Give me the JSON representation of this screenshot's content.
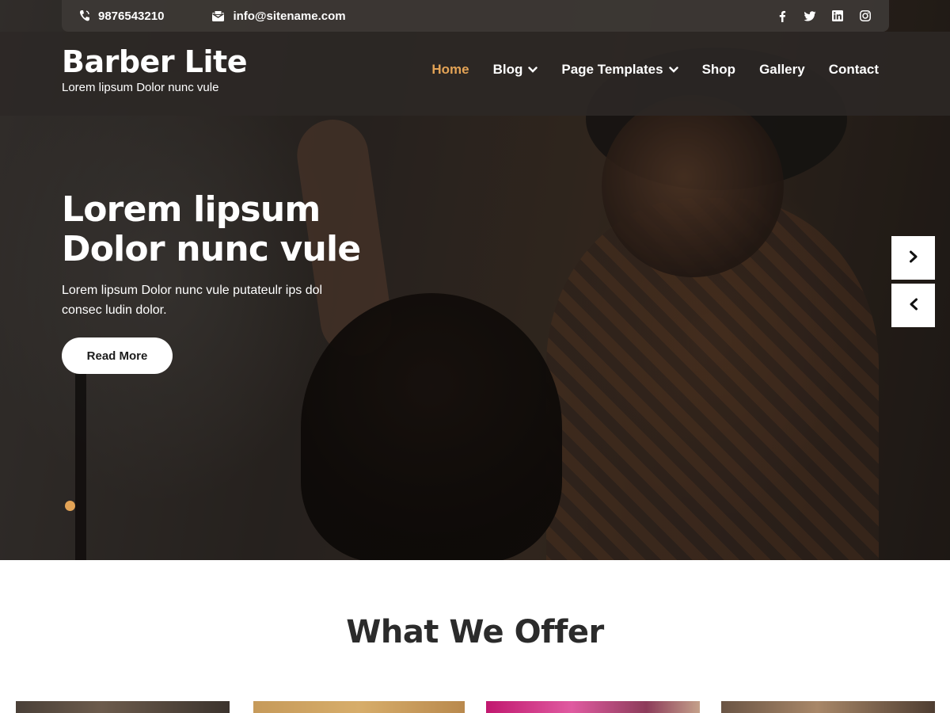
{
  "topbar": {
    "phone": "9876543210",
    "email": "info@sitename.com",
    "social": [
      {
        "icon": "facebook-icon",
        "glyph": "f"
      },
      {
        "icon": "twitter-icon",
        "glyph": ""
      },
      {
        "icon": "linkedin-icon",
        "glyph": ""
      },
      {
        "icon": "instagram-icon",
        "glyph": ""
      }
    ]
  },
  "header": {
    "site_title": "Barber Lite",
    "tagline": "Lorem lipsum Dolor nunc vule",
    "nav": [
      {
        "label": "Home",
        "active": true,
        "dropdown": false
      },
      {
        "label": "Blog",
        "active": false,
        "dropdown": true
      },
      {
        "label": "Page Templates",
        "active": false,
        "dropdown": true
      },
      {
        "label": "Shop",
        "active": false,
        "dropdown": false
      },
      {
        "label": "Gallery",
        "active": false,
        "dropdown": false
      },
      {
        "label": "Contact",
        "active": false,
        "dropdown": false
      }
    ]
  },
  "hero": {
    "heading_line1": "Lorem lipsum",
    "heading_line2": "Dolor nunc vule",
    "text": "Lorem lipsum Dolor nunc vule putateulr ips dol consec ludin dolor.",
    "button_label": "Read More",
    "active_slide": 1,
    "total_slides": 1
  },
  "offer": {
    "title": "What We Offer"
  },
  "colors": {
    "accent": "#e3a356",
    "topbar_bg": "#3c3835",
    "header_bg": "#2c2825"
  }
}
